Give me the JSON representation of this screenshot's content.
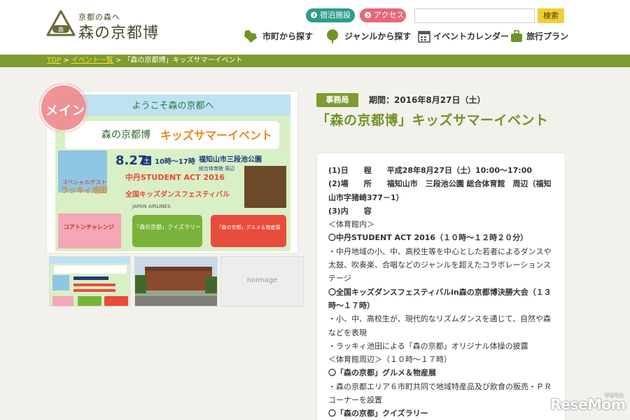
{
  "header": {
    "logo_small": "京都の森へ",
    "logo_big": "森の京都博",
    "lodging": "宿泊施設",
    "access": "アクセス",
    "search_placeholder": "",
    "search_button": "検索",
    "nav": {
      "city": "市町から探す",
      "genre": "ジャンルから探す",
      "event": "イベントカレンダー",
      "plan": "旅行プラン"
    }
  },
  "breadcrumb": {
    "top": "TOP",
    "sep1": ">",
    "events": "イベント一覧",
    "sep2": ">",
    "current": "「森の京都博」キッズサマーイベント"
  },
  "gallery": {
    "badge": "メイン",
    "poster": {
      "welcome": "ようこそ森の京都へ",
      "brand": "森の京都博",
      "headline": "キッズサマーイベント",
      "date": "8.27",
      "day": "土",
      "time": "10時〜17時",
      "venue": "福知山市三段池公園",
      "venue_sub": "総合体育館 周辺",
      "act1": "中丹STUDENT ACT 2016",
      "act2": "全国キッズダンスフェスティバル",
      "guest_label": "スペシャルゲスト",
      "guest": "ラッキィ池田",
      "box1": "「森の京都」クイズラリー",
      "box2": "「森の京都」グルメ＆物産展",
      "box3": "コアトンチャレンジ",
      "airline": "JAPAN AIRLINES"
    },
    "noimage": "noimage"
  },
  "detail": {
    "tag": "事務局",
    "period": "期間：2016年8月27日（土）",
    "title": "「森の京都博」キッズサマーイベント",
    "lines": [
      {
        "text": "(1)日　　程　　平成28年8月27日（土）10:00～17:00",
        "bold": true
      },
      {
        "text": "(2)場　　所　　福知山市　三段池公園 総合体育館　周辺（福知山市字猪崎377－1）",
        "bold": true
      },
      {
        "text": "(3)内　　容",
        "bold": true
      },
      {
        "text": "＜体育館内＞",
        "bold": false
      },
      {
        "text": "〇中丹STUDENT ACT 2016（１０時～１２時２０分）",
        "bold": true
      },
      {
        "text": "・中丹地域の小、中、高校生等を中心とした若者によるダンスや太鼓、吹奏楽、合唱などのジャンルを超えたコラボレーションステージ",
        "bold": false
      },
      {
        "text": "〇全国キッズダンスフェスティバルin森の京都博決勝大会（１３時～１７時）",
        "bold": true
      },
      {
        "text": "・小、中、高校生が、現代的なリズムダンスを通じて、自然や森などを表現",
        "bold": false
      },
      {
        "text": "・ラッキィ池田による「森の京都」オリジナル体操の披露",
        "bold": false
      },
      {
        "text": "＜体育館周辺＞（１０時～１７時）",
        "bold": false
      },
      {
        "text": "〇「森の京都」グルメ＆物産展",
        "bold": true
      },
      {
        "text": "・森の京都エリア６市町共同で地域特産品及び飲食の販売・ＰＲコーナーを設置",
        "bold": false
      },
      {
        "text": "〇「森の京都」クイズラリー",
        "bold": true
      }
    ]
  },
  "watermark": {
    "main": "ReseMom",
    "small": "リセマム"
  },
  "colors": {
    "green": "#7e9c2f",
    "title_green": "#6e9427",
    "teal": "#2d9c8c",
    "pink": "#e66878",
    "yellow": "#f1cd36"
  }
}
